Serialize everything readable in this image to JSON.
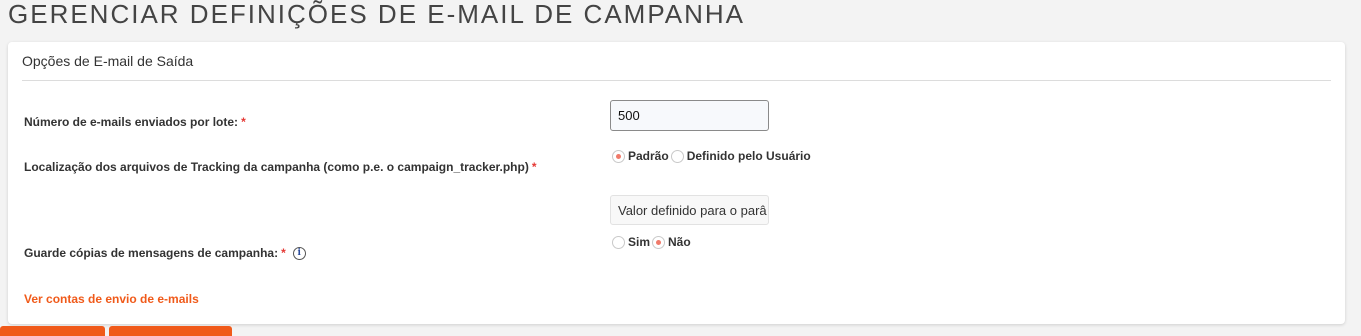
{
  "page": {
    "title": "GERENCIAR DEFINIÇÕES DE E-MAIL DE CAMPANHA"
  },
  "panel": {
    "header": "Opções de E-mail de Saída"
  },
  "fields": {
    "batch_size": {
      "label": "Número de e-mails enviados por lote:",
      "required_mark": "*",
      "value": "500"
    },
    "tracking_location": {
      "label": "Localização dos arquivos de Tracking da campanha (como p.e. o campaign_tracker.php)",
      "required_mark": "*",
      "options": [
        {
          "label": "Padrão",
          "checked": true
        },
        {
          "label": "Definido pelo Usuário",
          "checked": false
        }
      ],
      "custom_value": "Valor definido para o parâ"
    },
    "keep_copies": {
      "label": "Guarde cópias de mensagens de campanha:",
      "required_mark": "*",
      "info_icon": "i",
      "options": [
        {
          "label": "Sim",
          "checked": false
        },
        {
          "label": "Não",
          "checked": true
        }
      ]
    }
  },
  "links": {
    "view_accounts": "Ver contas de envio de e-mails"
  },
  "colors": {
    "accent": "#f05a1a",
    "radio_selected": "#f07a6a",
    "required": "#e53935"
  }
}
